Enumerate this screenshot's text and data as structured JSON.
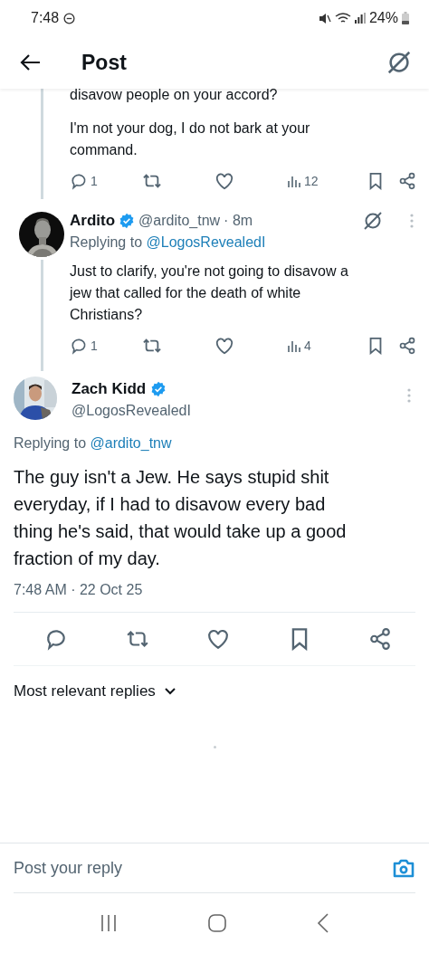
{
  "status_bar": {
    "time": "7:48",
    "battery": "24%"
  },
  "header": {
    "title": "Post"
  },
  "thread": [
    {
      "kind": "continuation",
      "cut_text": "disavow people on your accord?",
      "text": "I'm not your dog, I do not bark at your\ncommand.",
      "reply_count": "1",
      "view_count": "12"
    },
    {
      "kind": "reply",
      "name": "Ardito",
      "verified": true,
      "handle": "@ardito_tnw",
      "time": "· 8m",
      "replying_label": "Replying to",
      "replying_to": "@LogosRevealedI",
      "text": "Just to clarify, you're not going to disavow a\njew that called for the death of white\nChristians?",
      "reply_count": "1",
      "view_count": "4"
    }
  ],
  "main_post": {
    "name": "Zach Kidd",
    "verified": true,
    "handle": "@LogosRevealedI",
    "replying_label": "Replying to",
    "replying_to": "@ardito_tnw",
    "text": "The guy isn't a Jew. He says stupid shit\neveryday, if I had to disavow every bad\nthing he's said, that would take up a good\nfraction of my day.",
    "timestamp": "7:48 AM · 22 Oct 25"
  },
  "replies_filter": {
    "label": "Most relevant replies"
  },
  "reply_bar": {
    "placeholder": "Post your reply"
  }
}
